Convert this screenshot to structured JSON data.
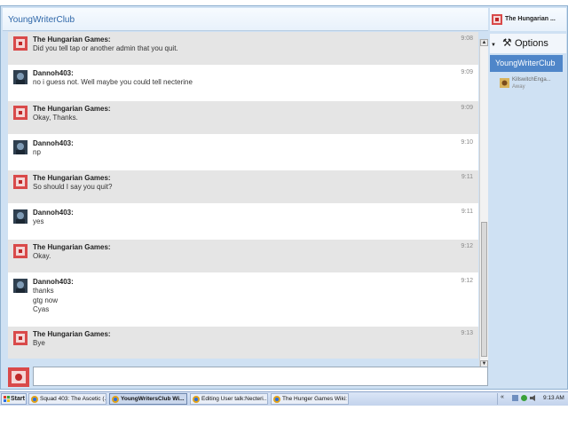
{
  "window": {
    "title": "YoungWriterClub"
  },
  "top_user": {
    "name": "The Hungarian ..."
  },
  "messages": [
    {
      "user": "The Hungarian Games:",
      "time": "9:08",
      "lines": [
        "Did you tell tap or another admin that you quit."
      ],
      "avatar": "hungarian-games-avatar"
    },
    {
      "user": "Dannoh403:",
      "time": "9:09",
      "lines": [
        "no i guess not. Well maybe you could tell necterine"
      ],
      "avatar": "dannoh-avatar"
    },
    {
      "user": "The Hungarian Games:",
      "time": "9:09",
      "lines": [
        "Okay, Thanks."
      ],
      "avatar": "hungarian-games-avatar"
    },
    {
      "user": "Dannoh403:",
      "time": "9:10",
      "lines": [
        "np"
      ],
      "avatar": "dannoh-avatar"
    },
    {
      "user": "The Hungarian Games:",
      "time": "9:11",
      "lines": [
        "So should I say you quit?"
      ],
      "avatar": "hungarian-games-avatar"
    },
    {
      "user": "Dannoh403:",
      "time": "9:11",
      "lines": [
        "yes"
      ],
      "avatar": "dannoh-avatar"
    },
    {
      "user": "The Hungarian Games:",
      "time": "9:12",
      "lines": [
        "Okay."
      ],
      "avatar": "hungarian-games-avatar"
    },
    {
      "user": "Dannoh403:",
      "time": "9:12",
      "lines": [
        "thanks",
        "gtg now",
        "Cyas"
      ],
      "avatar": "dannoh-avatar"
    },
    {
      "user": "The Hungarian Games:",
      "time": "9:13",
      "lines": [
        "Bye"
      ],
      "avatar": "hungarian-games-avatar"
    }
  ],
  "sidebar": {
    "options_label": "Options",
    "room_tab": "YoungWriterClub",
    "users": [
      {
        "name": "KillswitchEnga...",
        "status": "Away"
      }
    ]
  },
  "taskbar": {
    "start_label": "Start",
    "buttons": [
      {
        "label": "Squad 403: The Ascetic (...",
        "active": false
      },
      {
        "label": "YoungWritersClub Wi...",
        "active": true
      },
      {
        "label": "Editing User talk:Necteri...",
        "active": false
      },
      {
        "label": "The Hunger Games Wiki: ...",
        "active": false
      }
    ],
    "clock": "9:13 AM"
  },
  "colors": {
    "accent": "#4f86c9",
    "title_text": "#2d66a8",
    "message_shade": "#e5e5e5",
    "window_bg": "#cfe1f3"
  }
}
